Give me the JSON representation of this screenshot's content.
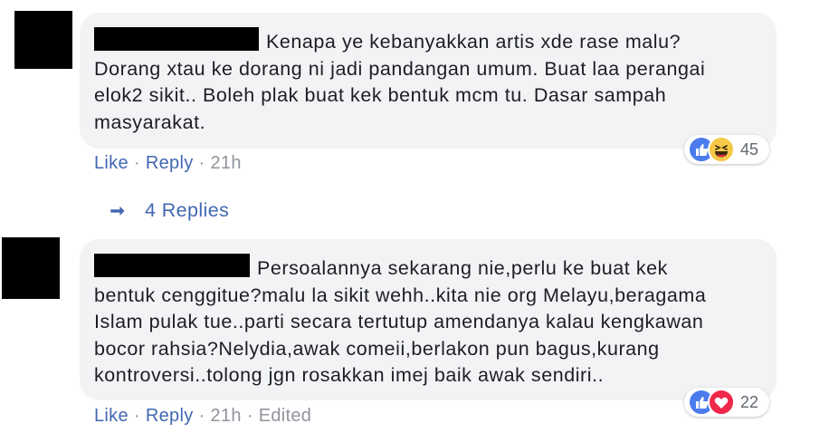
{
  "comments": [
    {
      "text": "Kenapa ye kebanyakkan artis xde rase malu?\nDorang xtau ke dorang ni jadi pandangan umum. Buat laa perangai\nelok2 sikit.. Boleh plak buat kek bentuk mcm tu. Dasar sampah\nmasyarakat.",
      "reactions": [
        "like-icon",
        "haha-icon"
      ],
      "reaction_count": "45",
      "actions": {
        "like": "Like",
        "reply": "Reply",
        "time": "21h"
      }
    },
    {
      "text": "Persoalannya sekarang nie,perlu ke buat kek\nbentuk cenggitue?malu la sikit wehh..kita nie org Melayu,beragama\nIslam pulak tue..parti secara tertutup amendanya kalau kengkawan\nbocor rahsia?Nelydia,awak comeii,berlakon pun bagus,kurang\nkontroversi..tolong jgn rosakkan imej baik awak sendiri..",
      "reactions": [
        "like-icon",
        "love-icon"
      ],
      "reaction_count": "22",
      "actions": {
        "like": "Like",
        "reply": "Reply",
        "time": "21h",
        "edited": "Edited"
      }
    }
  ],
  "replies_link": {
    "label": "4 Replies",
    "icon": "reply-arrow-icon"
  },
  "colors": {
    "bubble": "#f2f3f5",
    "link": "#4267b2",
    "meta": "#90949c",
    "text": "#1c1e21",
    "like_blue": "#4b7bec",
    "haha_yellow": "#f7c948",
    "love_red": "#f0284a"
  }
}
